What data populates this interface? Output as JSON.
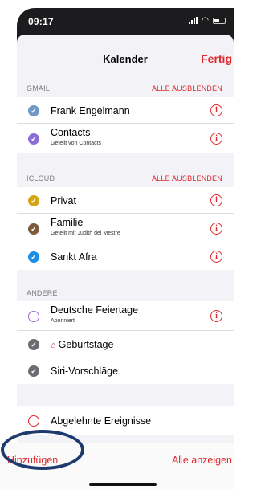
{
  "status": {
    "time": "09:17"
  },
  "header": {
    "title": "Kalender",
    "done": "Fertig"
  },
  "sections": [
    {
      "label": "GMAIL",
      "action": "ALLE AUSBLENDEN",
      "items": [
        {
          "name": "Frank Engelmann",
          "sub": "",
          "color": "#6e98c8",
          "checked": true,
          "info": true
        },
        {
          "name": "Contacts",
          "sub": "Geteilt von Contacts",
          "color": "#8b6fd6",
          "checked": true,
          "info": true
        }
      ]
    },
    {
      "label": "ICLOUD",
      "action": "ALLE AUSBLENDEN",
      "items": [
        {
          "name": "Privat",
          "sub": "",
          "color": "#d6a419",
          "checked": true,
          "info": true
        },
        {
          "name": "Familie",
          "sub": "Geteilt mit Judith del Mestre",
          "color": "#7d5c3e",
          "checked": true,
          "info": true
        },
        {
          "name": "Sankt Afra",
          "sub": "",
          "color": "#1d8ee8",
          "checked": true,
          "info": true
        }
      ]
    },
    {
      "label": "ANDERE",
      "action": "",
      "items": [
        {
          "name": "Deutsche Feiertage",
          "sub": "Abonniert",
          "color": "#a36ad8",
          "checked": false,
          "info": true
        },
        {
          "name": "Geburtstage",
          "sub": "",
          "color": "#6b6b72",
          "checked": true,
          "info": false
        },
        {
          "name": "Siri-Vorschläge",
          "sub": "",
          "color": "#6b6b72",
          "checked": true,
          "info": false
        }
      ]
    }
  ],
  "declined": {
    "name": "Abgelehnte Ereignisse",
    "color": "#e0282d",
    "checked": false
  },
  "footer": {
    "add": "Hinzufügen",
    "show_all": "Alle anzeigen"
  },
  "icons": {
    "checkmark": "✓",
    "info": "i",
    "gift": "🎁"
  }
}
